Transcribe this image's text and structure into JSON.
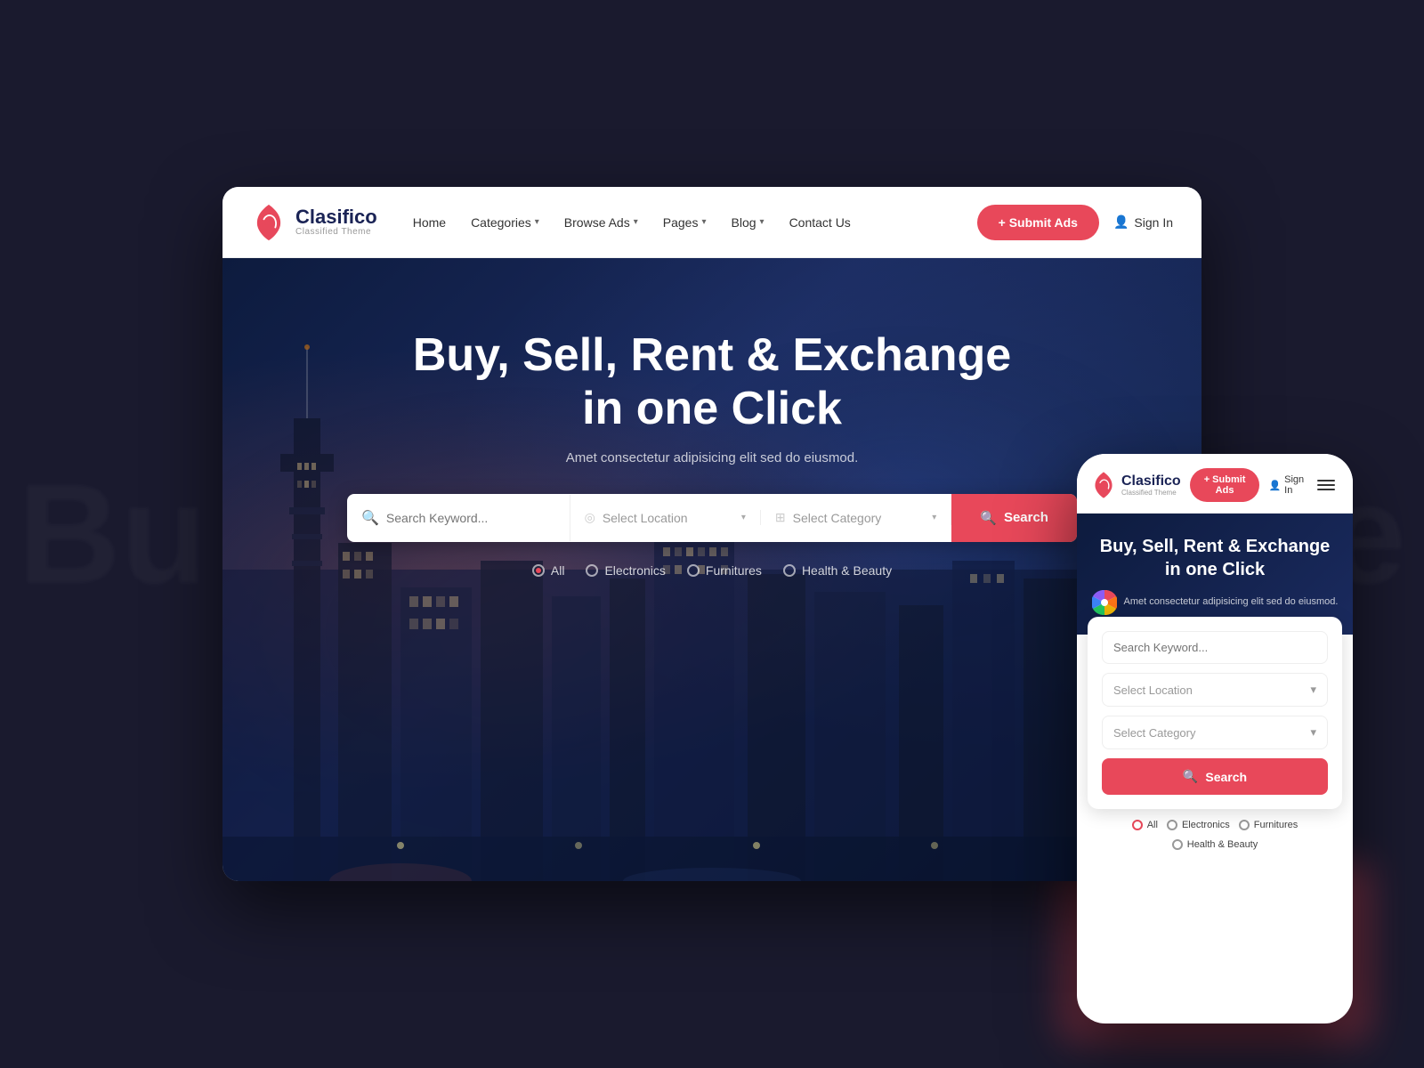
{
  "background": {
    "blur_text_left": "Bu",
    "blur_text_right": "e"
  },
  "desktop": {
    "navbar": {
      "logo_title": "Clasifico",
      "logo_subtitle": "Classified Theme",
      "nav_links": [
        {
          "label": "Home",
          "has_dropdown": true
        },
        {
          "label": "Categories",
          "has_dropdown": true
        },
        {
          "label": "Browse Ads",
          "has_dropdown": true
        },
        {
          "label": "Pages",
          "has_dropdown": true
        },
        {
          "label": "Blog",
          "has_dropdown": true
        },
        {
          "label": "Contact Us",
          "has_dropdown": false
        }
      ],
      "submit_btn": "+ Submit Ads",
      "sign_in": "Sign In"
    },
    "hero": {
      "title": "Buy, Sell, Rent & Exchange in one Click",
      "subtitle": "Amet consectetur adipisicing elit sed do eiusmod.",
      "search_placeholder": "Search Keyword...",
      "location_placeholder": "Select Location",
      "category_placeholder": "Select Category",
      "search_btn": "Search",
      "filter_tags": [
        {
          "label": "All",
          "active": true
        },
        {
          "label": "Electronics",
          "active": false
        },
        {
          "label": "Furnitures",
          "active": false
        },
        {
          "label": "Health & Beauty",
          "active": false
        }
      ]
    }
  },
  "mobile": {
    "navbar": {
      "logo_title": "Clasifico",
      "logo_subtitle": "Classified Theme",
      "submit_btn": "+ Submit Ads",
      "sign_in": "Sign In"
    },
    "hero": {
      "title": "Buy, Sell, Rent & Exchange in one Click",
      "subtitle": "Amet consectetur adipisicing elit sed do eiusmod."
    },
    "search": {
      "keyword_placeholder": "Search Keyword...",
      "location_placeholder": "Select Location",
      "category_placeholder": "Select Category",
      "search_btn": "Search"
    },
    "filter_tags": [
      {
        "label": "All"
      },
      {
        "label": "Electronics"
      },
      {
        "label": "Furnitures"
      },
      {
        "label": "Health & Beauty"
      }
    ]
  },
  "icons": {
    "search": "🔍",
    "location_pin": "◎",
    "grid": "⊞",
    "plus": "+",
    "user": "👤",
    "chevron_down": "▾",
    "hamburger": "☰",
    "arrow_down": "▾"
  }
}
